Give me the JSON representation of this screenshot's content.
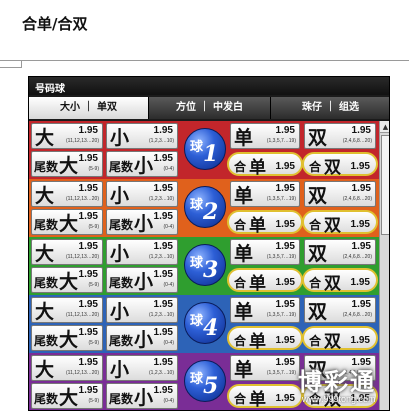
{
  "page": {
    "title": "合单/合双"
  },
  "panel": {
    "header": "号码球",
    "tabs": [
      {
        "label": "大小 ｜ 单双",
        "active": true
      },
      {
        "label": "方位 ｜ 中发白",
        "active": false
      },
      {
        "label": "珠仔 ｜ 组选",
        "active": false
      }
    ]
  },
  "labels": {
    "big": "大",
    "small": "小",
    "wei": "尾数",
    "odd": "单",
    "even": "双",
    "he": "合",
    "ball": "球"
  },
  "ranges": {
    "big": "(11,12,13…20)",
    "small": "(1,2,3…10)",
    "wei_big": "(5-9)",
    "wei_small": "(0-4)",
    "odd": "(1,3,5,7…19)",
    "even": "(2,4,6,8…20)"
  },
  "balls": [
    {
      "number": "1",
      "big": "1.95",
      "small": "1.95",
      "wei_big": "1.95",
      "wei_small": "1.95",
      "odd": "1.95",
      "even": "1.95",
      "he_odd": "1.95",
      "he_even": "1.95"
    },
    {
      "number": "2",
      "big": "1.95",
      "small": "1.95",
      "wei_big": "1.95",
      "wei_small": "1.95",
      "odd": "1.95",
      "even": "1.95",
      "he_odd": "1.95",
      "he_even": "1.95"
    },
    {
      "number": "3",
      "big": "1.95",
      "small": "1.95",
      "wei_big": "1.95",
      "wei_small": "1.95",
      "odd": "1.95",
      "even": "1.95",
      "he_odd": "1.95",
      "he_even": "1.95"
    },
    {
      "number": "4",
      "big": "1.95",
      "small": "1.95",
      "wei_big": "1.95",
      "wei_small": "1.95",
      "odd": "1.95",
      "even": "1.95",
      "he_odd": "1.95",
      "he_even": "1.95"
    },
    {
      "number": "5",
      "big": "1.95",
      "small": "1.95",
      "wei_big": "1.95",
      "wei_small": "1.95",
      "odd": "1.95",
      "even": "1.95",
      "he_odd": "1.95",
      "he_even": "1.95"
    }
  ],
  "row_colors": [
    "#c2262b",
    "#e0611c",
    "#2f9e2f",
    "#2d63b7",
    "#7a2d96"
  ],
  "highlight_color": "#e0c030",
  "watermark": {
    "text": "博彩通",
    "url": "www.999tong.com"
  }
}
